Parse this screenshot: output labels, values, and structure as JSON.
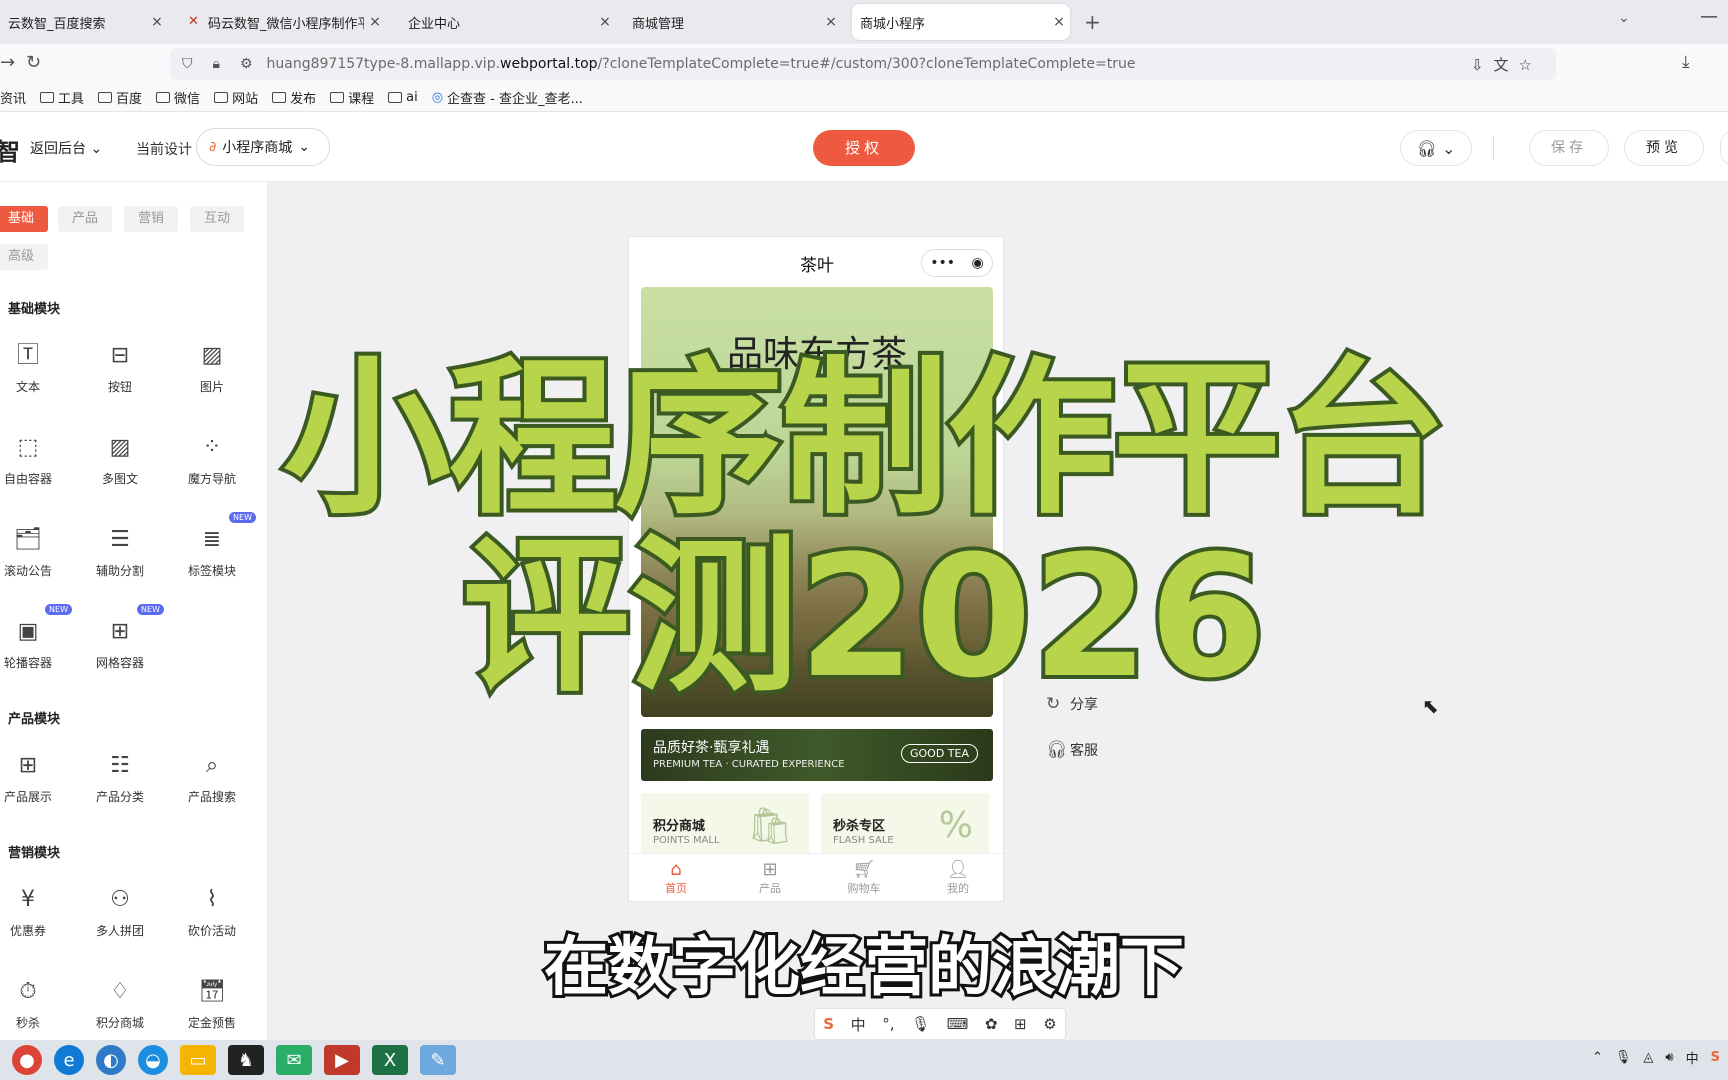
{
  "browser": {
    "tabs": [
      {
        "title": "云数智_百度搜索",
        "close": "×"
      },
      {
        "title": "码云数智_微信小程序制作平台_",
        "close": "×"
      },
      {
        "title": "企业中心",
        "close": "×"
      },
      {
        "title": "商城管理",
        "close": "×"
      },
      {
        "title": "商城小程序",
        "close": "×"
      }
    ],
    "new_tab": "+",
    "url_prefix": "huang897157type-8.mallapp.vip.",
    "url_domain": "webportal.top",
    "url_suffix": "/?cloneTemplateComplete=true#/custom/300?cloneTemplateComplete=true",
    "bookmarks": [
      "资讯",
      "工具",
      "百度",
      "微信",
      "网站",
      "发布",
      "课程",
      "ai",
      "企查查 - 查企业_查老..."
    ]
  },
  "editor": {
    "brand_glyph": "智",
    "back_label": "返回后台",
    "current_design_label": "当前设计",
    "design_select_value": "小程序商城",
    "auth_button": "授权",
    "save_button": "保存",
    "preview_button": "预览"
  },
  "left_panel": {
    "category_tabs": [
      "基础",
      "产品",
      "营销",
      "互动",
      "高级"
    ],
    "sections": {
      "basic": "基础模块",
      "product": "产品模块",
      "marketing": "营销模块"
    },
    "basic_widgets": [
      "文本",
      "按钮",
      "图片",
      "自由容器",
      "多图文",
      "魔方导航",
      "滚动公告",
      "辅助分割",
      "标签模块",
      "轮播容器",
      "网格容器"
    ],
    "product_widgets": [
      "产品展示",
      "产品分类",
      "产品搜索"
    ],
    "marketing_widgets": [
      "优惠券",
      "多人拼团",
      "砍价活动",
      "秒杀",
      "积分商城",
      "定金预售"
    ],
    "new_badge": "NEW"
  },
  "phone": {
    "title": "茶叶",
    "banner_title": "品味东方茶",
    "promo_cn": "品质好茶·甄享礼遇",
    "promo_en": "PREMIUM TEA · CURATED EXPERIENCE",
    "promo_tag": "GOOD TEA",
    "card1_title": "积分商城",
    "card1_sub": "POINTS MALL",
    "card2_title": "秒杀专区",
    "card2_sub": "FLASH SALE",
    "tabbar": [
      "首页",
      "产品",
      "购物车",
      "我的"
    ]
  },
  "side_menu": [
    "分享",
    "客服"
  ],
  "overlay": {
    "headline_line1": "小程序制作平台",
    "headline_line2": "评测2026",
    "subtitle": "在数字化经营的浪潮下"
  },
  "ime": {
    "logo": "S",
    "mode": "中"
  },
  "taskbar": {
    "tray_lang": "中"
  },
  "colors": {
    "accent": "#ee5a3f",
    "headline_fill": "#b8d44a",
    "headline_stroke": "#3b5a22"
  }
}
